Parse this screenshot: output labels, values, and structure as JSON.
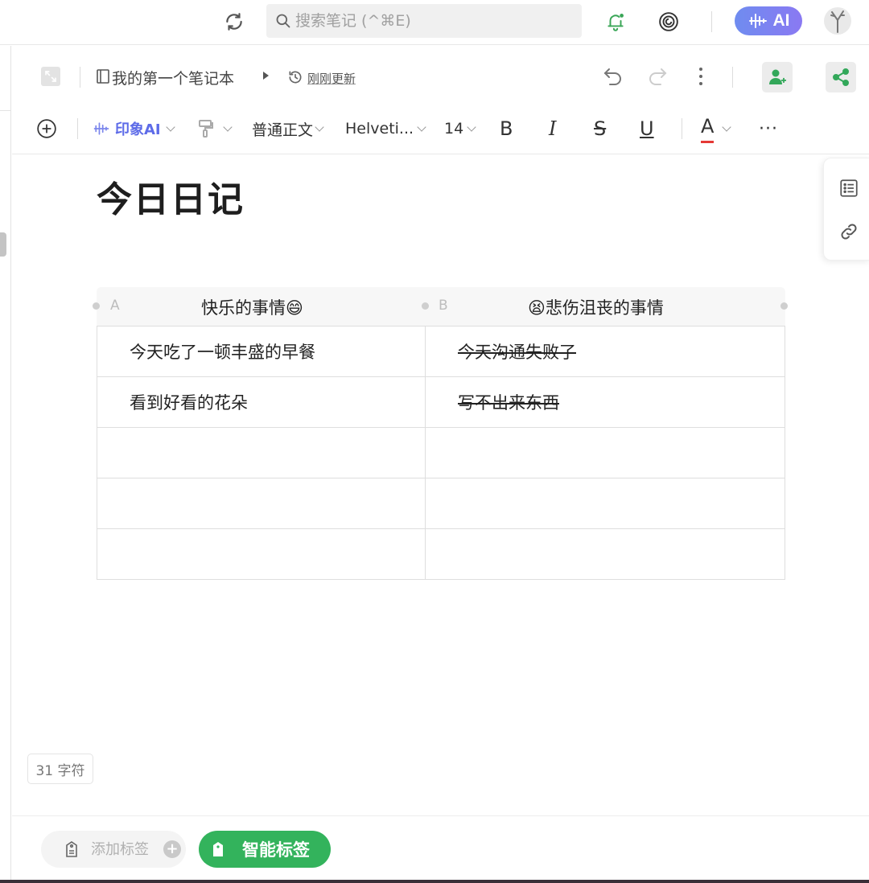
{
  "topbar": {
    "search_placeholder": "搜索笔记 (^⌘E)",
    "ai_label": "AI"
  },
  "note_header": {
    "notebook": "我的第一个笔记本",
    "updated": "刚刚更新"
  },
  "toolbar": {
    "ai_label": "印象AI",
    "paragraph_style": "普通正文",
    "font_family": "Helveti...",
    "font_size": "14",
    "bold": "B",
    "italic": "I",
    "strike": "S",
    "underline": "U",
    "font_color": "A",
    "more": "···",
    "colors": {
      "ai": "#5d6be8",
      "font_color_bar": "#e53935"
    }
  },
  "note": {
    "title": "今日日记",
    "table": {
      "columns": [
        {
          "letter": "A",
          "title": "快乐的事情😄"
        },
        {
          "letter": "B",
          "title": "😫悲伤沮丧的事情"
        }
      ],
      "rows": [
        [
          "今天吃了一顿丰盛的早餐",
          "今天沟通失败了"
        ],
        [
          "看到好看的花朵",
          "写不出来东西"
        ],
        [
          "",
          ""
        ],
        [
          "",
          ""
        ],
        [
          "",
          ""
        ]
      ]
    },
    "char_count": "31 字符"
  },
  "bottombar": {
    "add_tag_placeholder": "添加标签",
    "add_tag_plus": "+",
    "smart_tag_label": "智能标签",
    "colors": {
      "smart_tag": "#33b35c"
    }
  }
}
